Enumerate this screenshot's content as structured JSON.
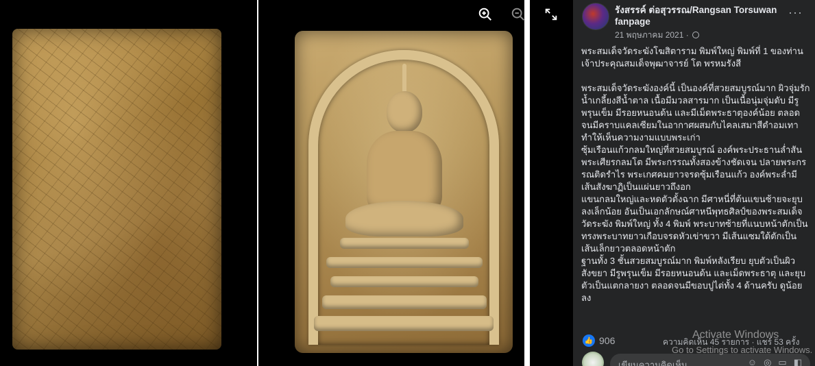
{
  "viewer": {
    "zoom_in_icon": "zoom-in-icon",
    "zoom_out_icon": "zoom-out-icon",
    "fullscreen_icon": "expand-icon"
  },
  "post": {
    "page_name": "รังสรรค์ ต่อสุวรรณ/Rangsan Torsuwan fanpage",
    "date": "21 พฤษภาคม 2021 ·",
    "more": "···",
    "text": "พระสมเด็จวัดระฆังโฆสิตาราม พิมพ์ใหญ่ พิมพ์ที่ 1 ของท่านเจ้าประคุณสมเด็จพุฒาจารย์ โต พรหมรังสี\n\nพระสมเด็จวัดระฆังองค์นี้ เป็นองค์ที่สวยสมบูรณ์มาก ผิวจุ่มรักน้ำเกลี้ยงสีน้ำตาล เนื้อมีมวลสารมาก เป็นเนื้อนุ่มจุ่มดับ มีรูพรุนเข็ม มีรอยหนอนด้น และมีเม็ดพระธาตุองค์น้อย ตลอดจนมีคราบแคลเซียมในอากาศผสมกับไคลเสมาสีดำอมเทา ทำให้เห็นความงามแบบพระเก่า\nซุ้มเรือนแก้วกลมใหญ่ที่สวยสมบูรณ์ องค์พระประธานล่ำสัน พระเศียรกลมโต มีพระกรรณทั้งสองข้างชัดเจน ปลายพระกรรณติดรำไร พระเกศคมยาวจรดซุ้มเรือนแก้ว องค์พระล่ำมีเส้นสังฆาฏิเป็นแผ่นยาวถึงอก\nแขนกลมใหญ่และหดตัวตั้งฉาก มีศาหนี่ที่ต้นแขนซ้ายจะยุบลงเล็กน้อย อันเป็นเอกลักษณ์ศาหนีพุทธศิลป์ของพระสมเด็จวัดระฆัง พิมพ์ใหญ่ ทั้ง 4 พิมพ์ พระบาทซ้ายที่แนบหน้าตักเป็นทรงพระบาทยาวเกือบจรดหัวเข่าขวา มีเส้นแซมใต้ตักเป็นเส้นเล็กยาวตลอดหน้าตัก\nฐานทั้ง 3 ชั้นสวยสมบูรณ์มาก พิมพ์หลังเรียบ ยุบตัวเป็นผิวสังขยา มีรูพรุนเข็ม มีรอยหนอนด้น และเม็ดพระธาตุ และยุบตัวเป็นแตกลายงา ตลอดจนมีขอบปูไต่ทั้ง 4 ด้านครับ ดูน้อยลง"
  },
  "reactions": {
    "like_count": "906",
    "stats": "ความคิดเห็น 45 รายการ · แชร์ 53 ครั้ง"
  },
  "comment": {
    "placeholder": "เขียนความคิดเห็น...",
    "icons": [
      "smile-icon",
      "camera-icon",
      "gif-icon",
      "sticker-icon"
    ]
  },
  "watermark": {
    "title": "Activate Windows",
    "subtitle": "Go to Settings to activate Windows."
  }
}
